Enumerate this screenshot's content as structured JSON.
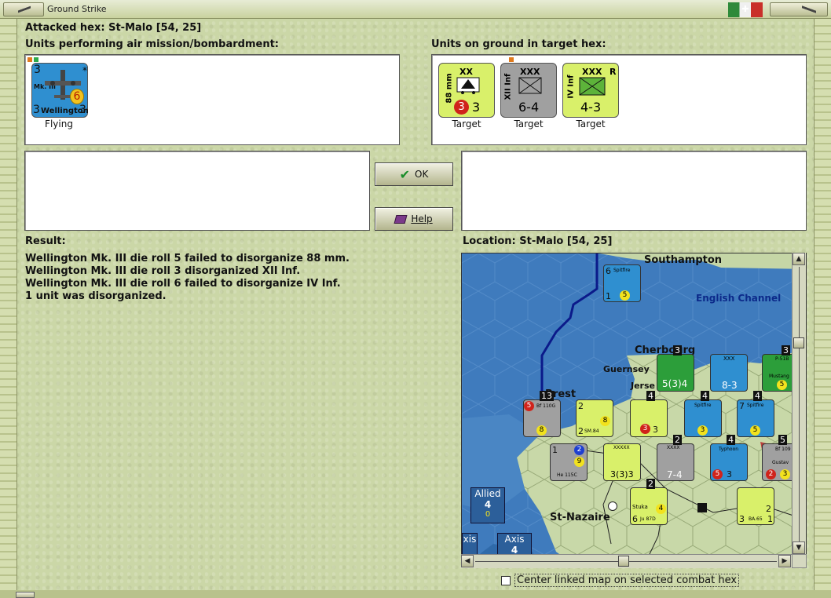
{
  "window": {
    "title": "Ground Strike"
  },
  "header": {
    "attacked_hex": "Attacked hex: St-Malo  [54, 25]"
  },
  "air_units": {
    "label": "Units performing air mission/bombardment:",
    "items": [
      {
        "name": "Wellington",
        "model": "Mk. III",
        "left_value": "3",
        "right_value": "3",
        "top_value": "3",
        "badge": "6",
        "status": "Flying",
        "color": "#2f8fd0"
      }
    ]
  },
  "ground_units": {
    "label": "Units on ground in target hex:",
    "items": [
      {
        "name": "88 mm",
        "size": "XX",
        "left_value": "3",
        "right_value": "3",
        "status": "Target",
        "color": "#d9f06a"
      },
      {
        "name": "XII Inf",
        "size": "XXX",
        "strength": "6-4",
        "status": "Target",
        "color": "#a0a0a0"
      },
      {
        "name": "IV Inf",
        "size": "XXX",
        "strength": "4-3",
        "flag": "R",
        "status": "Target",
        "color": "#d9f06a"
      }
    ]
  },
  "buttons": {
    "ok": "OK",
    "help": "Help"
  },
  "result": {
    "label": "Result:",
    "lines": [
      "Wellington Mk. III die roll 5 failed to disorganize 88 mm.",
      "Wellington Mk. III die roll 3 disorganized XII Inf.",
      "Wellington Mk. III die roll 6 failed to disorganize IV Inf.",
      "1 unit was disorganized."
    ]
  },
  "location": {
    "label": "Location:  St-Malo  [54, 25]",
    "places": {
      "southampton": "Southampton",
      "channel": "English Channel",
      "cherbourg": "Cherbourg",
      "guernsey": "Guernsey",
      "jersey": "Jerse",
      "brest": "Brest",
      "st_nazaire": "St-Nazaire"
    },
    "tally": {
      "allied_label": "Allied",
      "allied_count": "4",
      "allied_sub": "0",
      "axis_label": "Axis",
      "axis_count": "4",
      "axis_partial": "xis"
    },
    "counters": {
      "c1_name": "Spitfire",
      "c1_top": "6",
      "c1_left": "1",
      "c1_badge": "5",
      "c2_strength": "5(3)4",
      "c2_top": "3",
      "c3_strength": "8-3",
      "c3_size": "XXX",
      "c4_name": "P-51B",
      "c4_sub": "Mustang",
      "c4_top": "3",
      "c4_badge": "5",
      "c5_name": "Bf 110G",
      "c5_top": "5",
      "c5_badge": "8",
      "c5_stack": "13",
      "c6_name": "SM.84",
      "c6_top": "2",
      "c6_left": "2",
      "c6_badge": "8",
      "c7_top": "4",
      "c7_left": "3",
      "c7_right": "3",
      "c8_name": "Spitfire",
      "c8_top": "4",
      "c8_badge": "3",
      "c9_name": "Spitfire",
      "c9_top": "4",
      "c9_left": "7",
      "c9_badge": "5",
      "c10_name": "He 115C",
      "c10_top": "1",
      "c10_left": "2",
      "c10_badge": "9",
      "c11_strength": "3(3)3",
      "c11_size": "XXXXX",
      "c12_strength": "7-4",
      "c12_size": "XXXX",
      "c12_top": "2",
      "c13_name": "Typhoon",
      "c13_left": "5",
      "c13_badge": "3",
      "c13_top": "4",
      "c14_name": "Bf 109",
      "c14_sub": "Gustav",
      "c14_left": "2",
      "c14_badge": "3",
      "c14_top": "5",
      "c15_name": "Stuka",
      "c15_sub": "Ju 87D",
      "c15_left": "6",
      "c15_badge": "4",
      "c15_top": "2",
      "c16_name": "BA.65",
      "c16_left": "3",
      "c16_badge": "2",
      "c16_right": "1"
    }
  },
  "options": {
    "center_map": "Center linked map on selected combat hex"
  }
}
